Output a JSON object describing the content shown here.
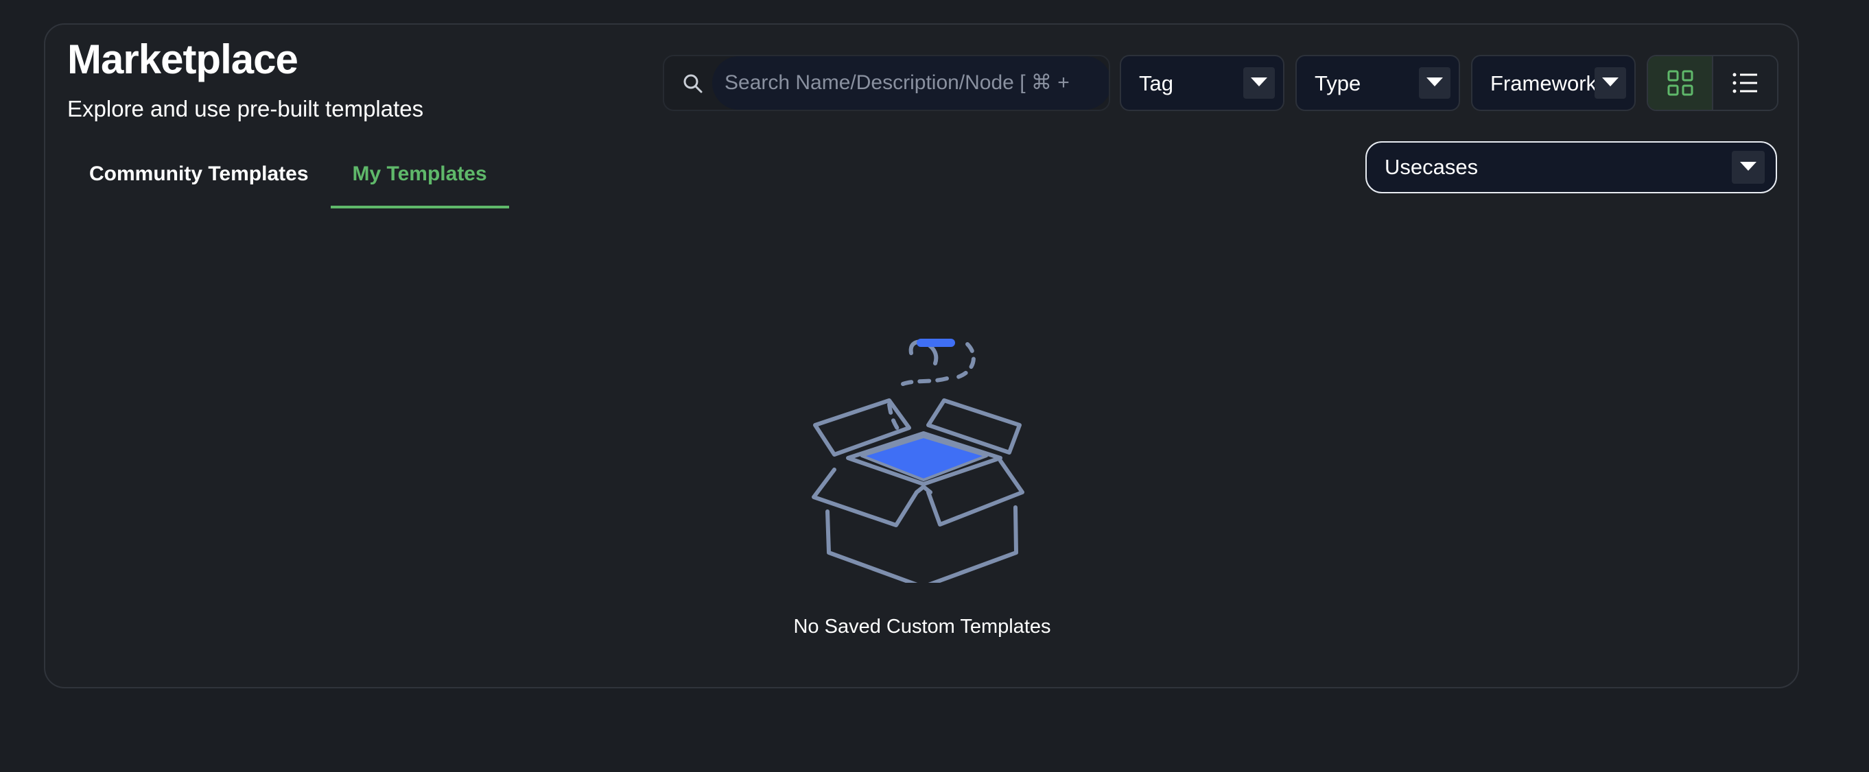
{
  "header": {
    "title": "Marketplace",
    "subtitle": "Explore and use pre-built templates"
  },
  "search": {
    "placeholder": "Search Name/Description/Node [ ⌘ +",
    "value": ""
  },
  "filters": {
    "tag": {
      "label": "Tag"
    },
    "type": {
      "label": "Type"
    },
    "framework": {
      "label": "Framework"
    },
    "usecases": {
      "label": "Usecases"
    }
  },
  "view_toggle": {
    "active": "grid",
    "options": [
      "grid",
      "list"
    ]
  },
  "tabs": [
    {
      "label": "Community Templates",
      "active": false
    },
    {
      "label": "My Templates",
      "active": true
    }
  ],
  "empty_state": {
    "icon": "open-box-icon",
    "message": "No Saved Custom Templates"
  },
  "colors": {
    "accent_green": "#5fb86a",
    "illustration_blue": "#3f6ff5",
    "illustration_stroke": "#7e8fae",
    "background": "#1b1e23"
  }
}
